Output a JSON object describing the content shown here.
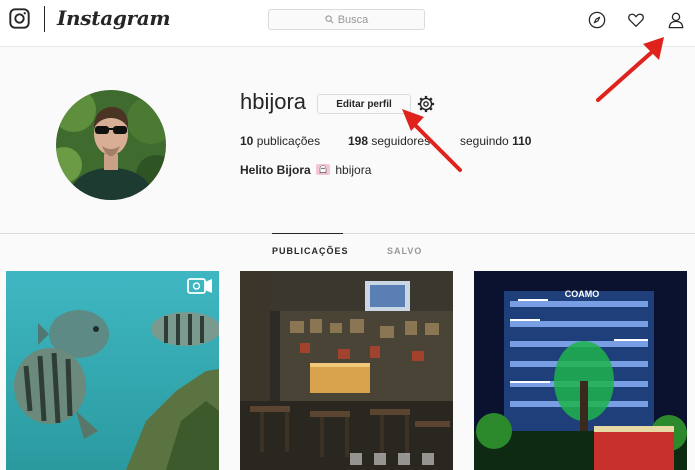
{
  "topbar": {
    "wordmark": "Instagram",
    "search_placeholder": "Busca",
    "icons": [
      "instagram-logo-icon",
      "search-icon",
      "explore-compass-icon",
      "activity-heart-icon",
      "profile-person-icon"
    ]
  },
  "profile": {
    "username": "hbijora",
    "edit_button": "Editar perfil",
    "stats": {
      "posts_count": "10",
      "posts_label": "publicações",
      "followers_count": "198",
      "followers_label": "seguidores",
      "following_label": "seguindo",
      "following_count": "110"
    },
    "full_name": "Helito Bijora",
    "badge_icon": "ghost-badge-icon",
    "bio_handle": "hbijora"
  },
  "tabs": {
    "posts": "PUBLICAÇÕES",
    "saved": "SALVO"
  },
  "posts": [
    {
      "description": "fish-aquarium",
      "video_icon": "video-camera-icon"
    },
    {
      "description": "bar-interior"
    },
    {
      "description": "lit-building-night",
      "sign": "COAMO"
    }
  ],
  "colors": {
    "background": "#fafafa",
    "border": "#dbdbdb",
    "text": "#262626",
    "muted": "#999999",
    "annotation_arrow": "#e0221c"
  }
}
